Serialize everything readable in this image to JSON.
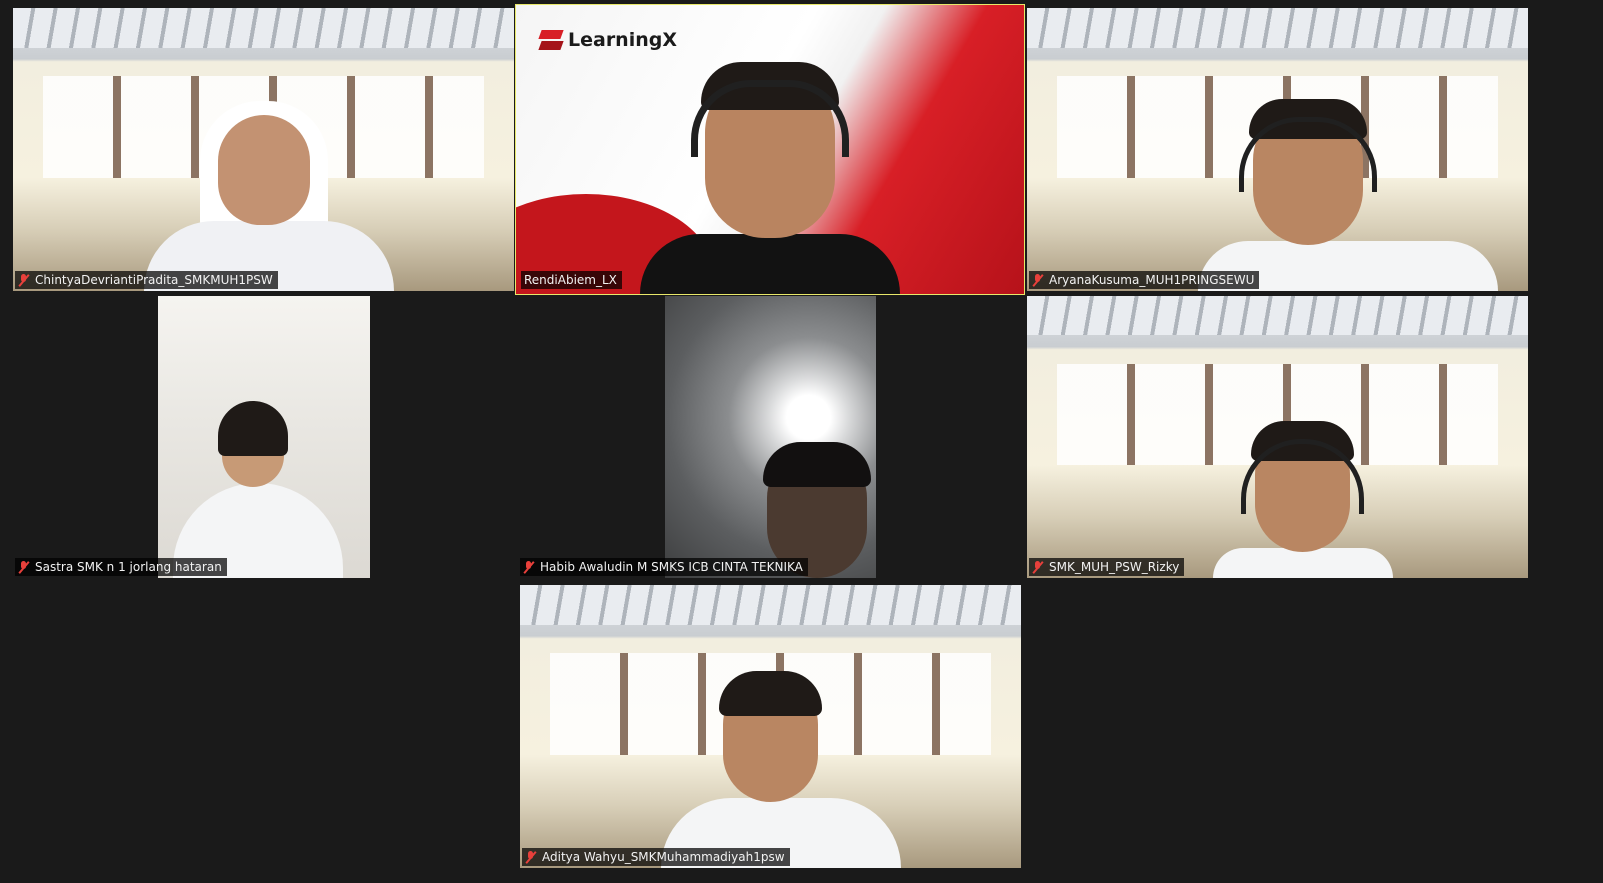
{
  "participants": [
    {
      "name": "ChintyaDevriantiPradita_SMKMUH1PSW",
      "muted": true,
      "active": false
    },
    {
      "name": "RendiAbiem_LX",
      "muted": false,
      "active": true,
      "background_logo": "LearningX"
    },
    {
      "name": "AryanaKusuma_MUH1PRINGSEWU",
      "muted": true,
      "active": false
    },
    {
      "name": "Sastra SMK n 1 jorlang hataran",
      "muted": true,
      "active": false
    },
    {
      "name": "Habib Awaludin M SMKS ICB CINTA TEKNIKA",
      "muted": true,
      "active": false
    },
    {
      "name": "SMK_MUH_PSW_Rizky",
      "muted": true,
      "active": false
    },
    {
      "name": "Aditya Wahyu_SMKMuhammadiyah1psw",
      "muted": true,
      "active": false
    }
  ],
  "colors": {
    "background": "#1a1a1a",
    "active_speaker_border": "#e8e86a",
    "muted_icon": "#e8403b",
    "brand_red": "#d81f26"
  }
}
